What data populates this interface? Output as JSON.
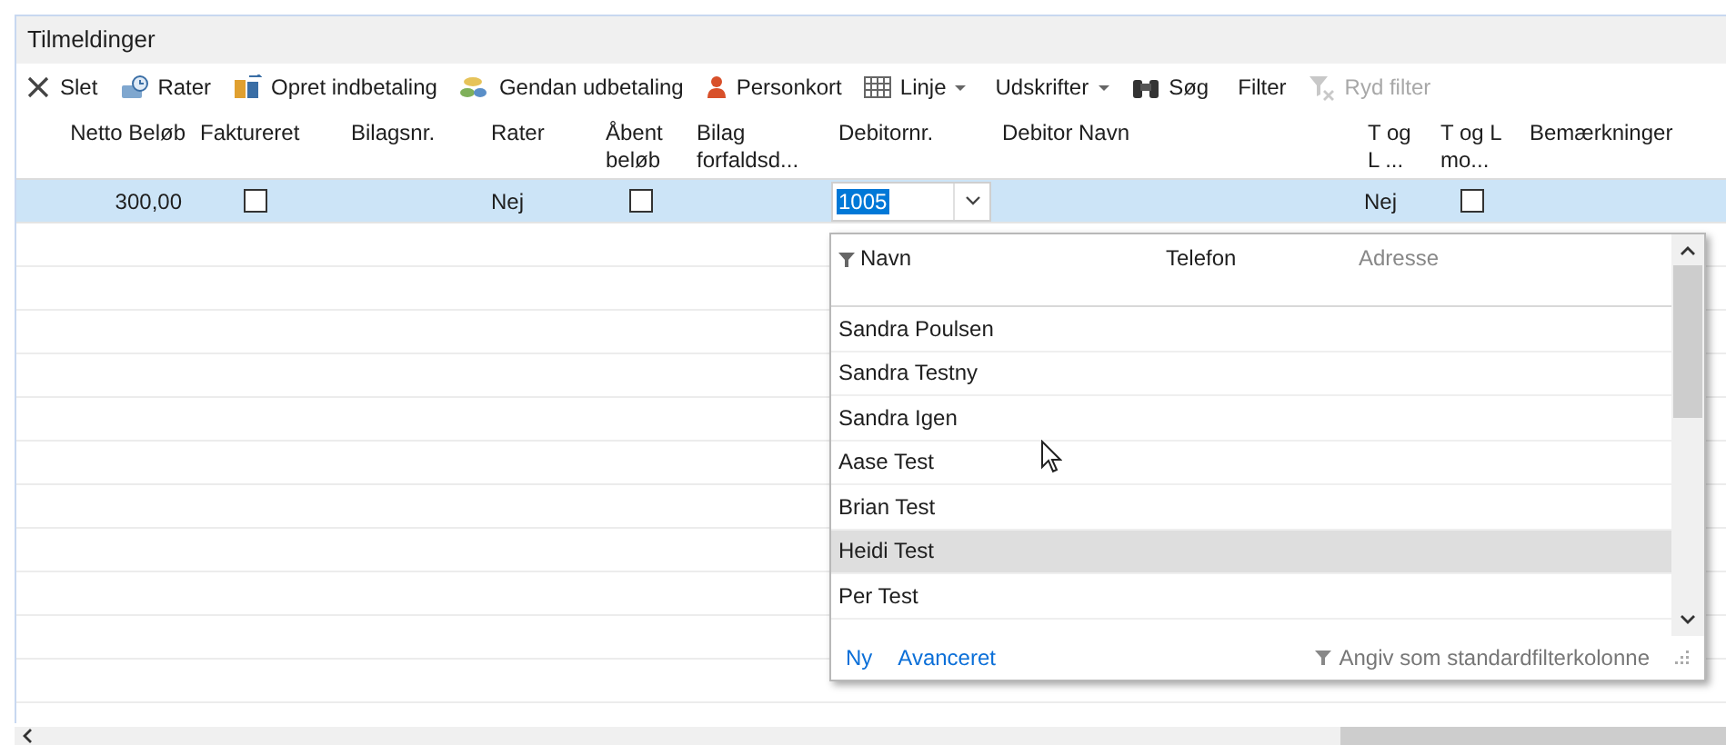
{
  "panel": {
    "title": "Tilmeldinger"
  },
  "toolbar": [
    {
      "label": "Slet",
      "dropdown": false,
      "disabled": false
    },
    {
      "label": "Rater",
      "dropdown": false,
      "disabled": false
    },
    {
      "label": "Opret indbetaling",
      "dropdown": false,
      "disabled": false
    },
    {
      "label": "Gendan udbetaling",
      "dropdown": false,
      "disabled": false
    },
    {
      "label": "Personkort",
      "dropdown": false,
      "disabled": false
    },
    {
      "label": "Linje",
      "dropdown": true,
      "disabled": false
    },
    {
      "label": "Udskrifter",
      "dropdown": true,
      "disabled": false
    },
    {
      "label": "Søg",
      "dropdown": false,
      "disabled": false
    },
    {
      "label": "Filter",
      "dropdown": false,
      "disabled": false
    },
    {
      "label": "Ryd filter",
      "dropdown": false,
      "disabled": true
    }
  ],
  "table": {
    "columns": [
      {
        "label": "Netto Beløb"
      },
      {
        "label": "Faktureret"
      },
      {
        "label": "Bilagsnr."
      },
      {
        "label": "Rater"
      },
      {
        "label": "Åbent beløb"
      },
      {
        "label": "Bilag forfaldsd..."
      },
      {
        "label": "Debitornr."
      },
      {
        "label": "Debitor Navn"
      },
      {
        "label": "T og L ..."
      },
      {
        "label": "T og L mo..."
      },
      {
        "label": "Bemærkninger"
      }
    ],
    "rows": [
      {
        "selected": true,
        "cells": [
          {
            "kind": "text",
            "text": "300,00"
          },
          {
            "kind": "check",
            "checked": false
          },
          {
            "kind": "empty"
          },
          {
            "kind": "text",
            "text": "Nej"
          },
          {
            "kind": "check",
            "checked": false
          },
          {
            "kind": "empty"
          },
          {
            "kind": "combo",
            "text": "1005"
          },
          {
            "kind": "empty"
          },
          {
            "kind": "text",
            "text": "Nej"
          },
          {
            "kind": "check",
            "checked": false
          },
          {
            "kind": "empty"
          }
        ]
      }
    ]
  },
  "lookup": {
    "columns": [
      {
        "label": "Navn",
        "filter": true,
        "dimmed": false
      },
      {
        "label": "Telefon",
        "filter": false,
        "dimmed": false
      },
      {
        "label": "Adresse",
        "filter": false,
        "dimmed": true
      }
    ],
    "rows": [
      {
        "name": "Sandra Poulsen",
        "selected": false
      },
      {
        "name": "Sandra Testny",
        "selected": false
      },
      {
        "name": "Sandra Igen",
        "selected": false
      },
      {
        "name": "Aase Test",
        "selected": false
      },
      {
        "name": "Brian Test",
        "selected": false
      },
      {
        "name": "Heidi Test",
        "selected": true
      },
      {
        "name": "Per Test",
        "selected": false
      }
    ],
    "links": [
      "Ny",
      "Avanceret"
    ],
    "filter_action": "Angiv som standardfilterkolonne"
  }
}
